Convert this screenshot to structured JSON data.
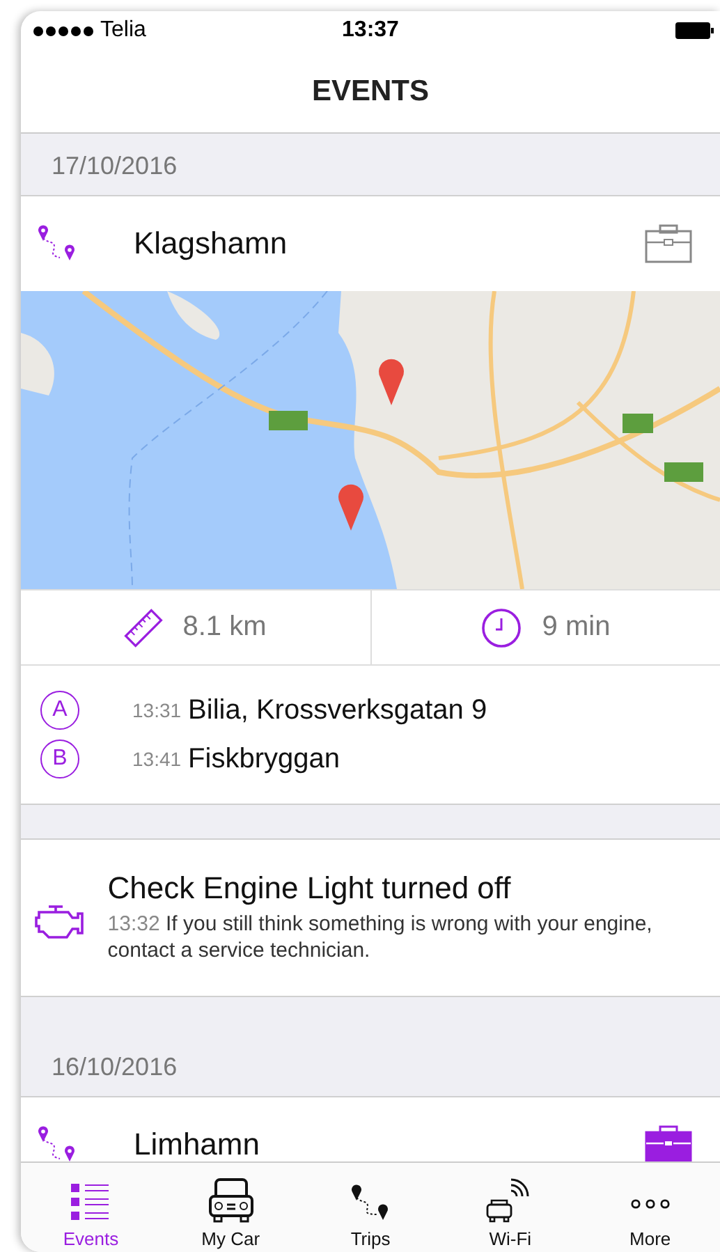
{
  "status_bar": {
    "carrier": "Telia",
    "time": "13:37"
  },
  "header": {
    "title": "EVENTS"
  },
  "sections": [
    {
      "date": "17/10/2016",
      "events": [
        {
          "kind": "trip",
          "title": "Klagshamn",
          "business": false,
          "distance": "8.1 km",
          "duration": "9 min",
          "stops": [
            {
              "marker": "A",
              "time": "13:31",
              "place": "Bilia, Krossverksgatan 9"
            },
            {
              "marker": "B",
              "time": "13:41",
              "place": "Fiskbryggan"
            }
          ]
        },
        {
          "kind": "alert",
          "title": "Check Engine Light turned off",
          "time": "13:32",
          "message": "If you still think something is wrong with your engine, contact a service technician."
        }
      ]
    },
    {
      "date": "16/10/2016",
      "events": [
        {
          "kind": "trip",
          "title": "Limhamn",
          "business": true
        }
      ]
    }
  ],
  "tabs": [
    {
      "label": "Events",
      "selected": true
    },
    {
      "label": "My Car",
      "selected": false
    },
    {
      "label": "Trips",
      "selected": false
    },
    {
      "label": "Wi-Fi",
      "selected": false
    },
    {
      "label": "More",
      "selected": false
    }
  ]
}
